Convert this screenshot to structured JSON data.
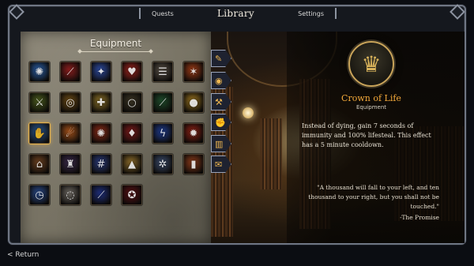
{
  "nav": {
    "tabs": [
      {
        "label": "Quests",
        "active": false
      },
      {
        "label": "Library",
        "active": true
      },
      {
        "label": "Settings",
        "active": false
      }
    ]
  },
  "equipment": {
    "title": "Equipment",
    "selected_index": 12,
    "slots": [
      {
        "icon": "blue-claw-icon",
        "glyph": "✺",
        "color": "#2a5fa8"
      },
      {
        "icon": "red-feather-icon",
        "glyph": "⟋",
        "color": "#8a1e1e"
      },
      {
        "icon": "blue-bolt-icon",
        "glyph": "✦",
        "color": "#2c4aa0"
      },
      {
        "icon": "red-heart-icon",
        "glyph": "♥",
        "color": "#a0241e"
      },
      {
        "icon": "scroll-icon",
        "glyph": "☰",
        "color": "#5a5248"
      },
      {
        "icon": "fire-claw-icon",
        "glyph": "✶",
        "color": "#9a3a16"
      },
      {
        "icon": "green-blade-icon",
        "glyph": "⚔",
        "color": "#4a5a1e"
      },
      {
        "icon": "golden-ring-icon",
        "glyph": "◎",
        "color": "#6a4a16"
      },
      {
        "icon": "golden-sword-icon",
        "glyph": "✚",
        "color": "#8a7028"
      },
      {
        "icon": "amulet-icon",
        "glyph": "○",
        "color": "#3a3424"
      },
      {
        "icon": "green-wand-icon",
        "glyph": "⟋",
        "color": "#1e4a2a"
      },
      {
        "icon": "golden-pouch-icon",
        "glyph": "●",
        "color": "#9a7420"
      },
      {
        "icon": "blue-gauntlet-icon",
        "glyph": "✋",
        "color": "#2a5a96"
      },
      {
        "icon": "orange-claw-icon",
        "glyph": "☄",
        "color": "#a0501a"
      },
      {
        "icon": "fire-swirl-icon",
        "glyph": "✺",
        "color": "#8a2a16"
      },
      {
        "icon": "red-potion-icon",
        "glyph": "♦",
        "color": "#7a1a1a"
      },
      {
        "icon": "lightning-icon",
        "glyph": "ϟ",
        "color": "#1e3a8a"
      },
      {
        "icon": "red-sun-icon",
        "glyph": "✹",
        "color": "#8a2014"
      },
      {
        "icon": "bronze-helmet-icon",
        "glyph": "⌂",
        "color": "#6a4020"
      },
      {
        "icon": "purple-potion-icon",
        "glyph": "♜",
        "color": "#3a2a4a"
      },
      {
        "icon": "blue-lattice-icon",
        "glyph": "#",
        "color": "#2a3a7a"
      },
      {
        "icon": "gold-bag-icon",
        "glyph": "▲",
        "color": "#8a6a2a"
      },
      {
        "icon": "silver-gear-icon",
        "glyph": "✲",
        "color": "#3a4a6a"
      },
      {
        "icon": "flame-tome-icon",
        "glyph": "▮",
        "color": "#8a3a1a"
      },
      {
        "icon": "blue-clock-icon",
        "glyph": "◷",
        "color": "#2a4a8a"
      },
      {
        "icon": "faded-orb-icon",
        "glyph": "◌",
        "color": "#6a6660"
      },
      {
        "icon": "blue-dagger-icon",
        "glyph": "⟋",
        "color": "#1e2e7a"
      },
      {
        "icon": "red-rune-icon",
        "glyph": "✪",
        "color": "#5a1216"
      }
    ]
  },
  "spine_icons": [
    {
      "icon": "quill-icon",
      "glyph": "✎"
    },
    {
      "icon": "medal-icon",
      "glyph": "◉"
    },
    {
      "icon": "hammer-icon",
      "glyph": "⚒"
    },
    {
      "icon": "fist-icon",
      "glyph": "✊"
    },
    {
      "icon": "book-icon",
      "glyph": "▥"
    },
    {
      "icon": "scroll-icon",
      "glyph": "✉"
    }
  ],
  "detail": {
    "icon": "crown-icon",
    "name": "Crown of Life",
    "type": "Equipment",
    "description": "Instead of dying, gain 7 seconds of immunity and 100% lifesteal. This effect has a 5 minute cooldown.",
    "quote": "\"A thousand will fall to your left, and ten thousand to your right, but you shall not be touched.\"",
    "quote_source": "-The Promise"
  },
  "footer": {
    "return_label": "< Return"
  }
}
